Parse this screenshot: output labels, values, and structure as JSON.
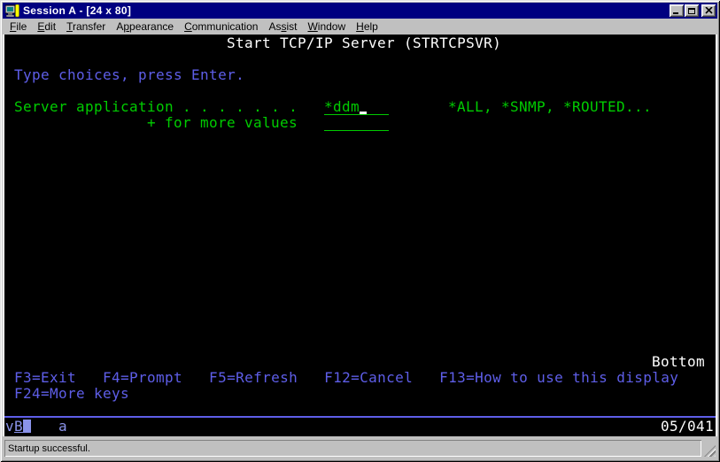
{
  "window": {
    "title": "Session A - [24 x 80]"
  },
  "menu": {
    "items": [
      {
        "pre": "",
        "key": "F",
        "post": "ile"
      },
      {
        "pre": "",
        "key": "E",
        "post": "dit"
      },
      {
        "pre": "",
        "key": "T",
        "post": "ransfer"
      },
      {
        "pre": "A",
        "key": "p",
        "post": "pearance"
      },
      {
        "pre": "",
        "key": "C",
        "post": "ommunication"
      },
      {
        "pre": "As",
        "key": "s",
        "post": "ist"
      },
      {
        "pre": "",
        "key": "W",
        "post": "indow"
      },
      {
        "pre": "",
        "key": "H",
        "post": "elp"
      }
    ]
  },
  "screen": {
    "title": "Start TCP/IP Server (STRTCPSVR)",
    "instruction": "Type choices, press Enter.",
    "field_label": "Server application . . . . . . .",
    "field_value": "*ddm",
    "field_hint": "*ALL, *SNMP, *ROUTED...",
    "more_values_label": "+ for more values",
    "bottom_marker": "Bottom",
    "fkeys_line1": "F3=Exit   F4=Prompt   F5=Refresh   F12=Cancel   F13=How to use this display",
    "fkeys_line2": "F24=More keys",
    "colors": {
      "text_green": "#00cc00",
      "text_blue": "#5e5ee8",
      "text_white": "#ffffff",
      "oia_blue": "#8a93ea",
      "background": "#000000",
      "titlebar": "#000080"
    }
  },
  "oia": {
    "indicator_1": "v",
    "indicator_2": "B",
    "shift_indicator": "a",
    "cursor_position": "05/041"
  },
  "statusbar": {
    "message": "Startup successful."
  }
}
